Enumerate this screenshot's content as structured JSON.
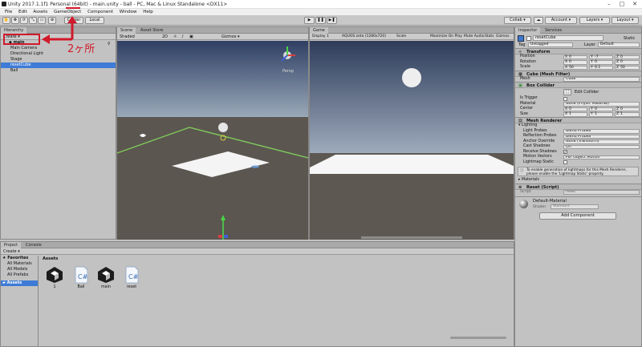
{
  "window": {
    "title": "Unity 2017.1.1f1 Personal (64bit) - main.unity - ball - PC, Mac & Linux Standalone <DX11>",
    "minimize": "–",
    "maximize": "□",
    "close": "✕"
  },
  "menu": [
    "File",
    "Edit",
    "Assets",
    "GameObject",
    "Component",
    "Window",
    "Help"
  ],
  "toolbar": {
    "pivot": "Center",
    "space": "Local",
    "collab": "Collab ▾",
    "account": "Account ▾",
    "layers": "Layers ▾",
    "layout": "Layout ▾"
  },
  "hierarchy": {
    "tab": "Hierarchy",
    "create": "Create ▾",
    "scene": "main",
    "items": [
      "Main Camera",
      "Directional Light",
      "Stage",
      "resetCube",
      "Ball"
    ],
    "selected_index": 3
  },
  "annotation": {
    "label": "2ヶ所",
    "color": "#d11a2a"
  },
  "scene_view": {
    "tabs": [
      "Scene",
      "Asset Store"
    ],
    "shading": "Shaded",
    "mode": "2D",
    "gizmos": "Gizmos ▾",
    "persp": "Persp"
  },
  "game_view": {
    "tab": "Game",
    "display": "Display 1",
    "aspect": "AQUOS zeta (1280x720)",
    "scale": "Scale",
    "options": [
      "Maximize On Play",
      "Mute Audio",
      "Stats",
      "Gizmos"
    ]
  },
  "inspector": {
    "tabs": [
      "Inspector",
      "Services"
    ],
    "object_name": "resetCube",
    "static": "Static",
    "tag_label": "Tag",
    "tag": "Untagged",
    "layer_label": "Layer",
    "layer": "Default",
    "transform": {
      "title": "Transform",
      "position_label": "Position",
      "position": [
        "0",
        "-7",
        "0"
      ],
      "rotation_label": "Rotation",
      "rotation": [
        "0",
        "0",
        "0"
      ],
      "scale_label": "Scale",
      "scale": [
        "50",
        "0.1",
        "50"
      ]
    },
    "mesh_filter": {
      "title": "Cube (Mesh Filter)",
      "mesh_label": "Mesh",
      "mesh": "Cube"
    },
    "box_collider": {
      "title": "Box Collider",
      "edit": "Edit Collider",
      "is_trigger": "Is Trigger",
      "material_label": "Material",
      "material": "None (Physic Material)",
      "center_label": "Center",
      "center": [
        "0",
        "0",
        "0"
      ],
      "size_label": "Size",
      "size": [
        "1",
        "1",
        "1"
      ]
    },
    "mesh_renderer": {
      "title": "Mesh Renderer",
      "lighting": "Lighting",
      "rows": [
        {
          "label": "Light Probes",
          "value": "Blend Probes"
        },
        {
          "label": "Reflection Probes",
          "value": "Blend Probes"
        },
        {
          "label": "Anchor Override",
          "value": "None (Transform)"
        },
        {
          "label": "Cast Shadows",
          "value": "On"
        },
        {
          "label": "Receive Shadows",
          "value": "✔"
        },
        {
          "label": "Motion Vectors",
          "value": "Per Object Motion"
        },
        {
          "label": "Lightmap Static",
          "value": ""
        }
      ],
      "info": "To enable generation of lightmaps for this Mesh Renderer, please enable the 'Lightmap Static' property."
    },
    "materials": "Materials",
    "script_comp": {
      "title": "Reset (Script)",
      "script_label": "Script",
      "script": "reset"
    },
    "material": {
      "name": "Default-Material",
      "shader_label": "Shader",
      "shader": "Standard"
    },
    "add_component": "Add Component"
  },
  "project": {
    "tabs": [
      "Project",
      "Console"
    ],
    "create": "Create ▾",
    "favorites": "Favorites",
    "fav_items": [
      "All Materials",
      "All Models",
      "All Prefabs"
    ],
    "assets_root": "Assets",
    "breadcrumb": "Assets",
    "assets": [
      {
        "name": "1",
        "kind": "unity"
      },
      {
        "name": "Ball",
        "kind": "cs"
      },
      {
        "name": "main",
        "kind": "unity"
      },
      {
        "name": "reset",
        "kind": "cs"
      }
    ]
  }
}
